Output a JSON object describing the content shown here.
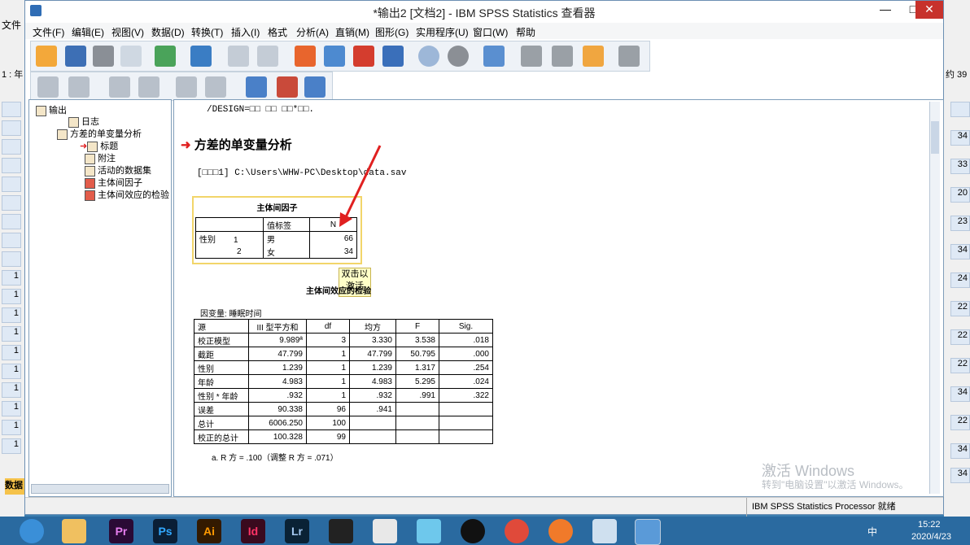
{
  "window": {
    "title": "*输出2 [文档2] - IBM SPSS Statistics 查看器",
    "minimize": "—",
    "maximize": "□",
    "close": "✕"
  },
  "bg_editor": {
    "menu_label": "文件",
    "cell_ref": "1 : 年",
    "right_label": "约 39",
    "tab_label": "数据"
  },
  "menu": [
    "文件(F)",
    "编辑(E)",
    "视图(V)",
    "数据(D)",
    "转换(T)",
    "插入(I)",
    "格式",
    "分析(A)",
    "直销(M)",
    "图形(G)",
    "实用程序(U)",
    "窗口(W)",
    "帮助"
  ],
  "tree": {
    "root": "输出",
    "log": "日志",
    "analysis": "方差的单变量分析",
    "title": "标题",
    "note": "附注",
    "dataset": "活动的数据集",
    "factors": "主体间因子",
    "effects": "主体间效应的检验"
  },
  "viewer": {
    "syntax_line": "/DESIGN=□□ □□ □□*□□.",
    "section_title": "方差的单变量分析",
    "dataset_line": "[□□□1] C:\\Users\\WHW-PC\\Desktop\\data.sav",
    "tooltip": [
      "双击以",
      "激活"
    ],
    "factors_table": {
      "title": "主体间因子",
      "col_label": "值标签",
      "col_n": "N",
      "var": "性别",
      "rows": [
        {
          "code": "1",
          "label": "男",
          "n": "66"
        },
        {
          "code": "2",
          "label": "女",
          "n": "34"
        }
      ]
    },
    "effects_title": "主体间效应的检验",
    "dep_var": "因变量: 睡眠时间",
    "effects_table": {
      "headers": [
        "源",
        "III 型平方和",
        "df",
        "均方",
        "F",
        "Sig."
      ],
      "rows": [
        [
          "校正模型",
          "9.989ª",
          "3",
          "3.330",
          "3.538",
          ".018"
        ],
        [
          "截距",
          "47.799",
          "1",
          "47.799",
          "50.795",
          ".000"
        ],
        [
          "性别",
          "1.239",
          "1",
          "1.239",
          "1.317",
          ".254"
        ],
        [
          "年龄",
          "4.983",
          "1",
          "4.983",
          "5.295",
          ".024"
        ],
        [
          "性别 * 年龄",
          ".932",
          "1",
          ".932",
          ".991",
          ".322"
        ],
        [
          "误差",
          "90.338",
          "96",
          ".941",
          "",
          ""
        ],
        [
          "总计",
          "6006.250",
          "100",
          "",
          "",
          ""
        ],
        [
          "校正的总计",
          "100.328",
          "99",
          "",
          "",
          ""
        ]
      ]
    },
    "footnote": "a. R 方 = .100（调整 R 方 = .071）"
  },
  "watermark": {
    "line1": "激活 Windows",
    "line2": "转到\"电脑设置\"以激活 Windows。"
  },
  "status": "IBM SPSS Statistics Processor 就绪",
  "taskbar": {
    "time": "15:22",
    "date": "2020/4/23",
    "ime": "中",
    "apps": [
      "Pr",
      "Ps",
      "Ai",
      "Id",
      "Lr"
    ]
  }
}
